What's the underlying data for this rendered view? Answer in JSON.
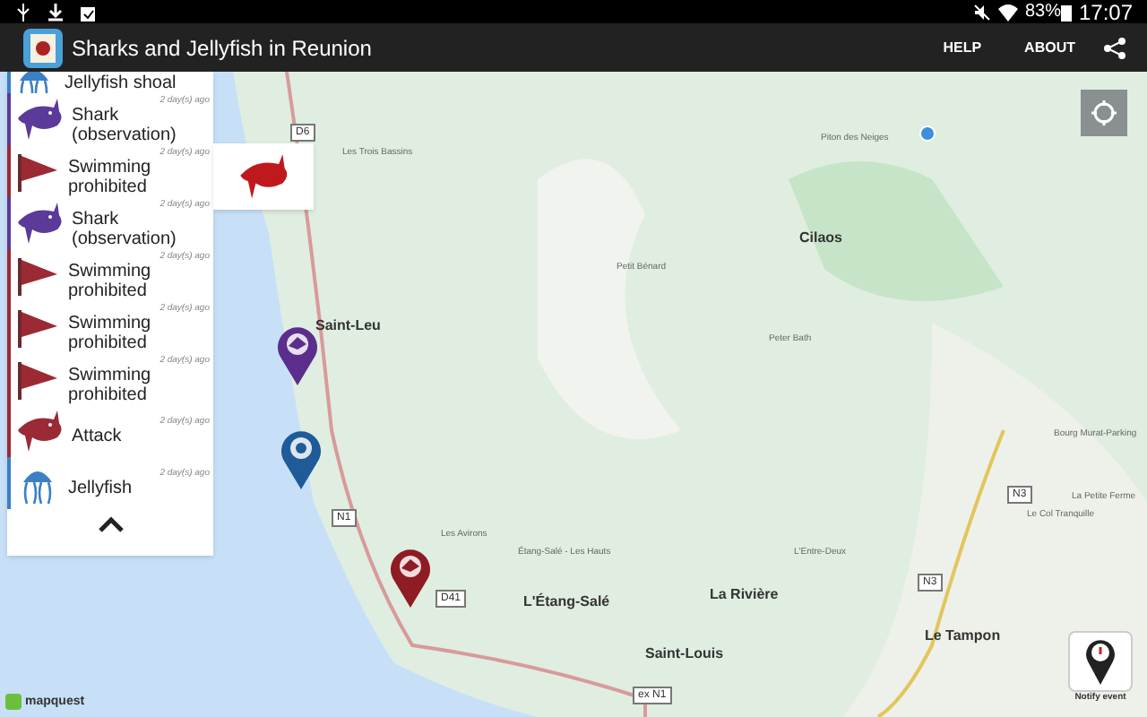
{
  "status_bar": {
    "battery": "83%",
    "time": "17:07"
  },
  "app_bar": {
    "title": "Sharks and Jellyfish in Reunion",
    "actions": [
      "HELP",
      "ABOUT"
    ]
  },
  "events": [
    {
      "kind": "jellyfish",
      "label": "Jellyfish shoal",
      "color": "#3b7fc4"
    },
    {
      "kind": "shark",
      "label": "Shark (observation)",
      "time": "2 day(s) ago",
      "color": "#5b3a9a"
    },
    {
      "kind": "flag",
      "label": "Swimming prohibited",
      "time": "2 day(s) ago",
      "color": "#9b2a35"
    },
    {
      "kind": "shark",
      "label": "Shark (observation)",
      "time": "2 day(s) ago",
      "color": "#5b3a9a"
    },
    {
      "kind": "flag",
      "label": "Swimming prohibited",
      "time": "2 day(s) ago",
      "color": "#9b2a35"
    },
    {
      "kind": "flag",
      "label": "Swimming prohibited",
      "time": "2 day(s) ago",
      "color": "#9b2a35"
    },
    {
      "kind": "flag",
      "label": "Swimming prohibited",
      "time": "2 day(s) ago",
      "color": "#9b2a35"
    },
    {
      "kind": "attack",
      "label": "Attack",
      "time": "2 day(s) ago",
      "color": "#9b2a35"
    },
    {
      "kind": "jellyfish",
      "label": "Jellyfish",
      "time": "2 day(s) ago",
      "color": "#3b7fc4"
    }
  ],
  "map": {
    "places": [
      {
        "kind": "town",
        "label": "Saint-Leu"
      },
      {
        "kind": "town",
        "label": "Cilaos"
      },
      {
        "kind": "town",
        "label": "L'Étang-Salé"
      },
      {
        "kind": "town",
        "label": "La Rivière"
      },
      {
        "kind": "town",
        "label": "Saint-Louis"
      },
      {
        "kind": "town",
        "label": "Le Tampon"
      },
      {
        "kind": "small",
        "label": "Les Trois Bassins"
      },
      {
        "kind": "small",
        "label": "Les Avirons"
      },
      {
        "kind": "small",
        "label": "Étang-Salé - Les Hauts"
      },
      {
        "kind": "small",
        "label": "L'Entre-Deux"
      },
      {
        "kind": "small",
        "label": "Bourg Murat-Parking"
      },
      {
        "kind": "small",
        "label": "La Petite Ferme"
      },
      {
        "kind": "small",
        "label": "Le Col Tranquille"
      },
      {
        "kind": "small",
        "label": "Piton des Neiges"
      },
      {
        "kind": "small",
        "label": "Petit Bénard"
      },
      {
        "kind": "small",
        "label": "Peter Bath"
      }
    ],
    "roads": [
      "D6",
      "N1",
      "D41",
      "N3",
      "N3",
      "ex N1"
    ],
    "pins": [
      {
        "kind": "shark",
        "color": "#5b2d8c"
      },
      {
        "kind": "jellyfish",
        "color": "#1f5b99"
      },
      {
        "kind": "attack",
        "color": "#8e1c22"
      }
    ],
    "notify": "Notify event",
    "attribution": "mapquest"
  }
}
